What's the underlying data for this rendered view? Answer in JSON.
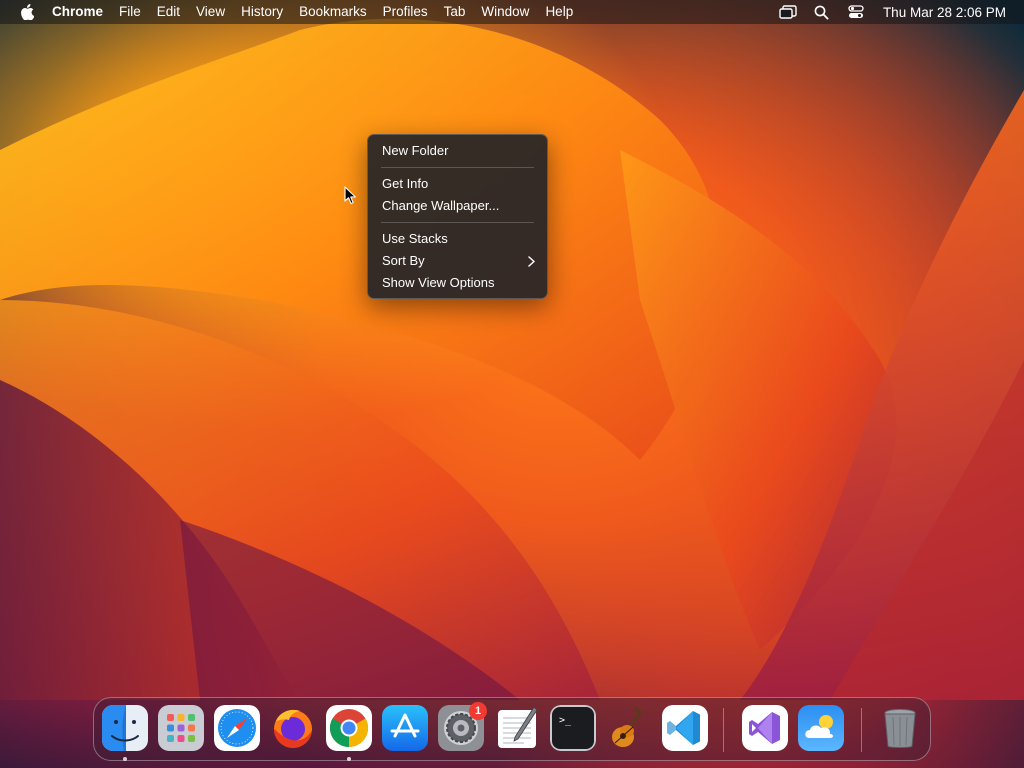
{
  "menubar": {
    "app_name": "Chrome",
    "items": [
      "File",
      "Edit",
      "View",
      "History",
      "Bookmarks",
      "Profiles",
      "Tab",
      "Window",
      "Help"
    ],
    "clock": "Thu Mar 28  2:06 PM"
  },
  "context_menu": {
    "items": [
      {
        "label": "New Folder"
      },
      {
        "label": "Get Info"
      },
      {
        "label": "Change Wallpaper..."
      },
      {
        "label": "Use Stacks"
      },
      {
        "label": "Sort By",
        "has_submenu": true
      },
      {
        "label": "Show View Options"
      }
    ]
  },
  "dock": {
    "apps": [
      {
        "icon": "finder-icon",
        "running": true
      },
      {
        "icon": "launchpad-icon",
        "running": false
      },
      {
        "icon": "safari-icon",
        "running": false
      },
      {
        "icon": "firefox-icon",
        "running": false
      },
      {
        "icon": "chrome-icon",
        "running": true
      },
      {
        "icon": "app-store-icon",
        "running": false
      },
      {
        "icon": "system-settings-icon",
        "running": false,
        "badge": "1"
      },
      {
        "icon": "textedit-icon",
        "running": false
      },
      {
        "icon": "terminal-icon",
        "running": false
      },
      {
        "icon": "garageband-icon",
        "running": false
      },
      {
        "icon": "vscode-icon",
        "running": false
      },
      {
        "icon": "visual-studio-icon",
        "running": false
      },
      {
        "icon": "weather-icon",
        "running": false
      },
      {
        "icon": "trash-icon",
        "running": false
      }
    ],
    "terminal_prompt": ">_"
  },
  "colors": {
    "menubar_bg": "#141418",
    "menu_bg": "#242428",
    "badge": "#f03a32",
    "wallpaper_orange": "#ff7a18"
  }
}
